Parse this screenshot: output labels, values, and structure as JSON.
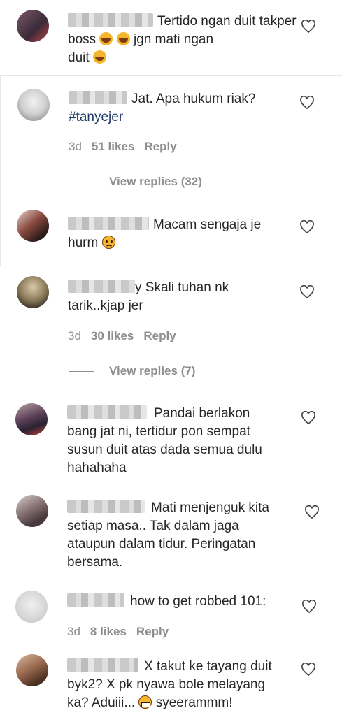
{
  "comments": [
    {
      "text": "Tertido ngan duit takper boss",
      "text2": "jgn mati ngan",
      "text3": "duit"
    },
    {
      "text": "Jat. Apa hukum riak?",
      "tag": "#tanyejer",
      "time": "3d",
      "likes": "51 likes",
      "reply": "Reply",
      "view_replies": "View replies (32)"
    },
    {
      "text": "Macam sengaja je",
      "text2": "hurm"
    },
    {
      "prefix": "y",
      "text": "Skali tuhan nk",
      "text2": "tarik..kjap jer",
      "time": "3d",
      "likes": "30 likes",
      "reply": "Reply",
      "view_replies": "View replies (7)"
    },
    {
      "text": "Pandai berlakon",
      "text2": "bang jat ni, tertidur pon sempat",
      "text3": "susun duit atas dada semua dulu",
      "text4": "hahahaha"
    },
    {
      "text": "Mati menjenguk kita",
      "text2": "setiap masa.. Tak dalam jaga",
      "text3": "ataupun dalam tidur. Peringatan",
      "text4": "bersama."
    },
    {
      "text": "how to get robbed 101:",
      "time": "3d",
      "likes": "8 likes",
      "reply": "Reply"
    },
    {
      "text": "X takut ke tayang duit",
      "text2": "byk2? X pk nyawa bole melayang",
      "text3": "ka? Aduiii...",
      "text4": "syeerammm!"
    }
  ],
  "colors": {
    "text": "#262626",
    "meta": "#8e8e8e",
    "hashtag": "#1f3a66",
    "emoji": "#f5b52e"
  },
  "icons": [
    "heart-outline-icon",
    "laughing-emoji",
    "worried-emoji",
    "grimace-emoji"
  ]
}
